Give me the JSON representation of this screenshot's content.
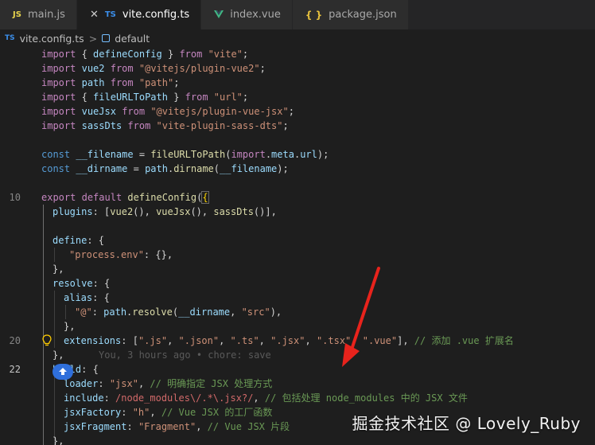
{
  "tabs": [
    {
      "icon": "JS",
      "label": "main.js",
      "active": false
    },
    {
      "icon": "TS",
      "label": "vite.config.ts",
      "active": true,
      "close": "✕"
    },
    {
      "icon": "V",
      "label": "index.vue",
      "active": false
    },
    {
      "icon": "{ }",
      "label": "package.json",
      "active": false
    }
  ],
  "breadcrumb": {
    "file_icon": "TS",
    "file": "vite.config.ts",
    "separator": ">",
    "symbol": "default"
  },
  "line_numbers": {
    "n10": "10",
    "n20": "20",
    "n22": "22"
  },
  "code": {
    "l1": [
      "import",
      " { ",
      "defineConfig",
      " } ",
      "from",
      " \"vite\"",
      ";"
    ],
    "l2": [
      "import",
      " ",
      "vue2",
      " ",
      "from",
      " \"@vitejs/plugin-vue2\"",
      ";"
    ],
    "l3": [
      "import",
      " ",
      "path",
      " ",
      "from",
      " \"path\"",
      ";"
    ],
    "l4": [
      "import",
      " { ",
      "fileURLToPath",
      " } ",
      "from",
      " \"url\"",
      ";"
    ],
    "l5": [
      "import",
      " ",
      "vueJsx",
      " ",
      "from",
      " \"@vitejs/plugin-vue-jsx\"",
      ";"
    ],
    "l6": [
      "import",
      " ",
      "sassDts",
      " ",
      "from",
      " \"vite-plugin-sass-dts\"",
      ";"
    ],
    "l8": [
      "const",
      " __filename",
      " = ",
      "fileURLToPath",
      "(",
      "import",
      ".",
      "meta",
      ".",
      "url",
      ");"
    ],
    "l9": [
      "const",
      " __dirname",
      " = ",
      "path",
      ".",
      "dirname",
      "(",
      "__filename",
      ");"
    ],
    "l11": [
      "export",
      " ",
      "default",
      " ",
      "defineConfig",
      "(",
      "{"
    ],
    "l12": [
      "plugins",
      ": [",
      "vue2",
      "(), ",
      "vueJsx",
      "(), ",
      "sassDts",
      "()],"
    ],
    "l14": [
      "define",
      ": {"
    ],
    "l15": [
      "\"process.env\"",
      ": {},"
    ],
    "l16": [
      "},"
    ],
    "l17": [
      "resolve",
      ": {"
    ],
    "l18": [
      "alias",
      ": {"
    ],
    "l19": [
      "\"@\"",
      ": ",
      "path",
      ".",
      "resolve",
      "(",
      "__dirname",
      ", ",
      "\"src\"",
      "),"
    ],
    "l20": [
      "},"
    ],
    "l21": [
      "extensions",
      ": [",
      "\".js\"",
      ", ",
      "\".json\"",
      ", ",
      "\".ts\"",
      ", ",
      "\".jsx\"",
      ", ",
      "\".tsx\"",
      ", ",
      "\".vue\"",
      "], ",
      "// 添加 .vue 扩展名"
    ],
    "l22": [
      "},"
    ],
    "l22_blame": "You, 3 hours ago • chore: save",
    "l23": [
      "build",
      ": {"
    ],
    "l24": [
      "loader",
      ": ",
      "\"jsx\"",
      ", ",
      "// 明确指定 JSX 处理方式"
    ],
    "l25": [
      "include",
      ": ",
      "/node_modules\\/.*\\.jsx?/",
      ", ",
      "// 包括处理 node_modules 中的 JSX 文件"
    ],
    "l26": [
      "jsxFactory",
      ": ",
      "\"h\"",
      ", ",
      "// Vue JSX 的工厂函数"
    ],
    "l27": [
      "jsxFragment",
      ": ",
      "\"Fragment\"",
      ", ",
      "// Vue JSX 片段"
    ],
    "l28": [
      "},"
    ]
  },
  "watermark": "掘金技术社区 @ Lovely_Ruby",
  "colors": {
    "accent": "#2f6fdb",
    "arrow": "#e8231c",
    "keyword": "#c586c0",
    "string": "#ce9178",
    "comment": "#6a9955"
  }
}
